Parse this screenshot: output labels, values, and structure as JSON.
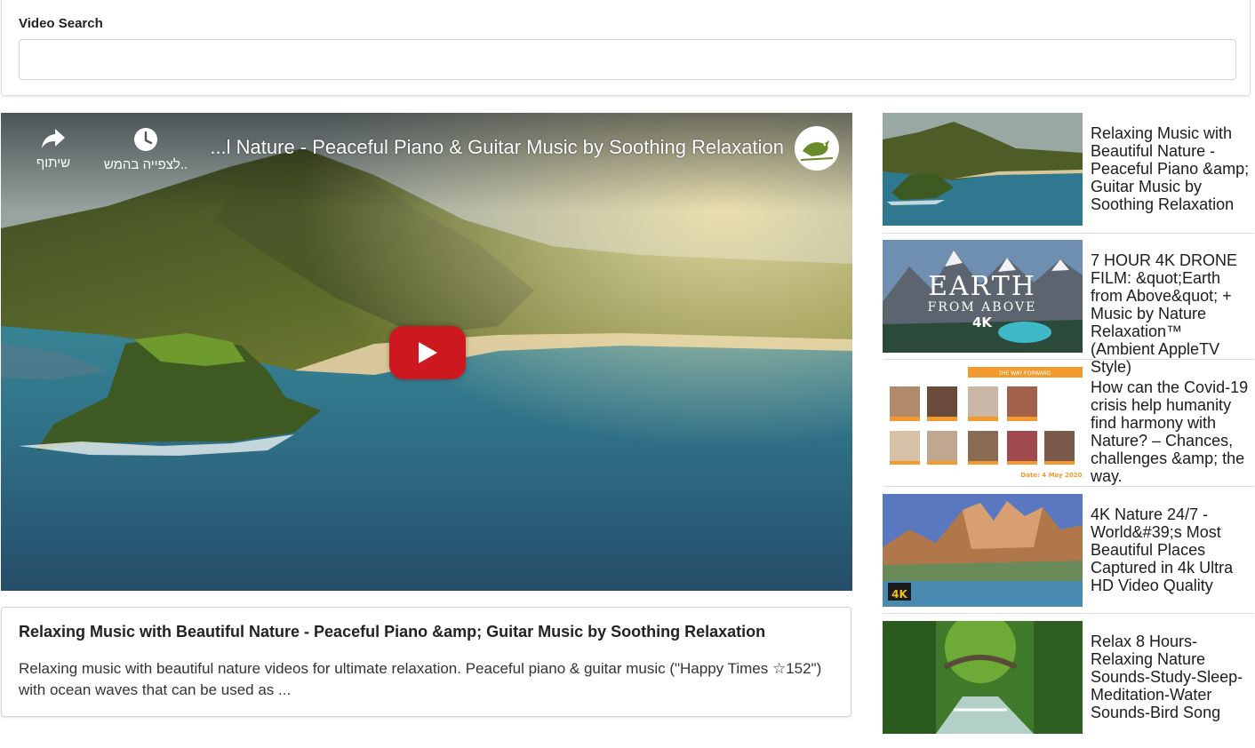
{
  "search": {
    "label": "Video Search",
    "value": "",
    "placeholder": ""
  },
  "player": {
    "title": "...l Nature - Peaceful Piano & Guitar Music by Soothing Relaxation",
    "share_label": "שיתוף",
    "watch_later_label": "לצפייה בהמש..",
    "share_icon": "share-arrow-icon",
    "watch_later_icon": "clock-icon",
    "play_icon": "youtube-play-icon",
    "brand_color": "#cc181e"
  },
  "selected_video": {
    "title": "Relaxing Music with Beautiful Nature - Peaceful Piano &amp; Guitar Music by Soothing Relaxation",
    "description": "Relaxing music with beautiful nature videos for ultimate relaxation. Peaceful piano & guitar music (\"Happy Times ☆152\") with ocean waves that can be used as ..."
  },
  "video_list": [
    {
      "title": "Relaxing Music with Beautiful Nature - Peaceful Piano &amp; Guitar Music by Soothing Relaxation"
    },
    {
      "title": "7 HOUR 4K DRONE FILM: &quot;Earth from Above&quot; + Music by Nature Relaxation™ (Ambient AppleTV Style)",
      "thumb_text": "EARTH",
      "thumb_sub": "FROM ABOVE",
      "thumb_badge": "4K"
    },
    {
      "title": "How can the Covid-19 crisis help humanity find harmony with Nature? – Chances, challenges &amp; the way.",
      "thumb_header": "THE WAY FORWARD",
      "thumb_date": "Date: 4 May 2020"
    },
    {
      "title": "4K Nature 24/7 - World&#39;s Most Beautiful Places Captured in 4k Ultra HD Video Quality",
      "thumb_badge": "4K"
    },
    {
      "title": "Relax 8 Hours-Relaxing Nature Sounds-Study-Sleep-Meditation-Water Sounds-Bird Song"
    }
  ]
}
